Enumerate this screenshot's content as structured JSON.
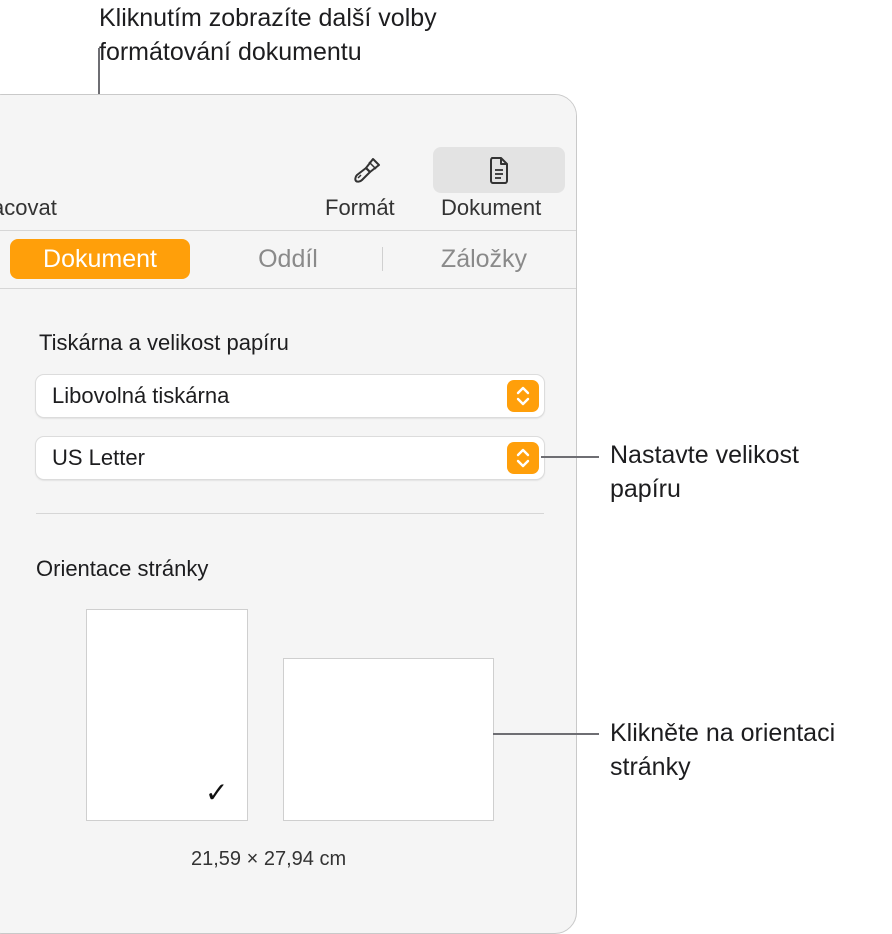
{
  "callouts": {
    "top_line1": "Kliknutím zobrazíte další volby",
    "top_line2": "formátování dokumentu",
    "paper_line1": "Nastavte velikost",
    "paper_line2": "papíru",
    "orient_line1": "Klikněte na orientaci",
    "orient_line2": "stránky"
  },
  "toolbar": {
    "partial_label": "acovat",
    "format_label": "Formát",
    "document_label": "Dokument",
    "format_icon": "paintbrush-icon",
    "document_icon": "document-icon"
  },
  "tabs": [
    {
      "label": "Dokument",
      "selected": true
    },
    {
      "label": "Oddíl",
      "selected": false
    },
    {
      "label": "Záložky",
      "selected": false
    }
  ],
  "printer_section": {
    "title": "Tiskárna a velikost papíru",
    "printer_value": "Libovolná tiskárna",
    "paper_value": "US Letter"
  },
  "orientation_section": {
    "title": "Orientace stránky",
    "selected": "portrait",
    "checkmark": "✓",
    "size": "21,59 × 27,94 cm"
  },
  "colors": {
    "accent": "#ff9f0a",
    "panel_bg": "#f5f5f5"
  }
}
